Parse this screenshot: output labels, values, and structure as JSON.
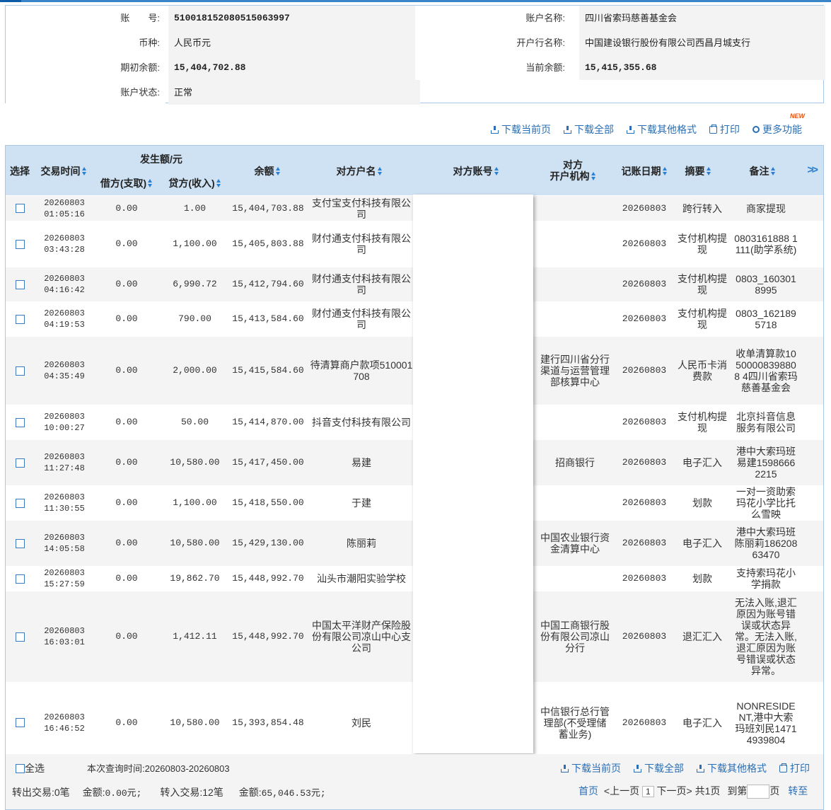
{
  "account": {
    "account_no_label": "账　　号:",
    "account_no": "510018152080515063997",
    "account_name_label": "账户名称:",
    "account_name": "四川省索玛慈善基金会",
    "currency_label": "币种:",
    "currency": "人民币元",
    "bank_label": "开户行名称:",
    "bank": "中国建设银行股份有限公司西昌月城支行",
    "opening_balance_label": "期初余额:",
    "opening_balance": "15,404,702.88",
    "current_balance_label": "当前余额:",
    "current_balance": "15,415,355.68",
    "status_label": "账户状态:",
    "status": "正常"
  },
  "toolbar": {
    "new_badge": "NEW",
    "download_page": "下载当前页",
    "download_all": "下载全部",
    "download_other": "下载其他格式",
    "print": "打印",
    "more": "更多功能"
  },
  "table": {
    "headers": {
      "select": "选择",
      "time": "交易时间",
      "amount_group": "发生额/元",
      "debit": "借方(支取)",
      "credit": "贷方(收入)",
      "balance": "余额",
      "counterparty": "对方户名",
      "counter_account": "对方账号",
      "counter_bank_1": "对方",
      "counter_bank_2": "开户机构",
      "post_date": "记账日期",
      "summary": "摘要",
      "remark": "备注",
      "more": ">>"
    },
    "rows": [
      {
        "date": "20260803",
        "time": "01:05:16",
        "debit": "0.00",
        "credit": "1.00",
        "balance": "15,404,703.88",
        "counterparty": "支付宝支付科技有限公司",
        "bank": "",
        "post": "20260803",
        "summary": "跨行转入",
        "remark": "商家提现"
      },
      {
        "date": "20260803",
        "time": "03:43:28",
        "debit": "0.00",
        "credit": "1,100.00",
        "balance": "15,405,803.88",
        "counterparty": "财付通支付科技有限公司",
        "bank": "",
        "post": "20260803",
        "summary": "支付机构提现",
        "remark": "0803161888 1111(助学系统)"
      },
      {
        "date": "20260803",
        "time": "04:16:42",
        "debit": "0.00",
        "credit": "6,990.72",
        "balance": "15,412,794.60",
        "counterparty": "财付通支付科技有限公司",
        "bank": "",
        "post": "20260803",
        "summary": "支付机构提现",
        "remark": "0803_1603018995"
      },
      {
        "date": "20260803",
        "time": "04:19:53",
        "debit": "0.00",
        "credit": "790.00",
        "balance": "15,413,584.60",
        "counterparty": "财付通支付科技有限公司",
        "bank": "",
        "post": "20260803",
        "summary": "支付机构提现",
        "remark": "0803_1621895718"
      },
      {
        "date": "20260803",
        "time": "04:35:49",
        "debit": "0.00",
        "credit": "2,000.00",
        "balance": "15,415,584.60",
        "counterparty": "待清算商户款项510001708",
        "bank": "建行四川省分行渠道与运营管理部核算中心",
        "post": "20260803",
        "summary": "人民币卡消费款",
        "remark": "收单清算款10500008398808 4四川省索玛慈善基金会"
      },
      {
        "date": "20260803",
        "time": "10:00:27",
        "debit": "0.00",
        "credit": "50.00",
        "balance": "15,414,870.00",
        "counterparty": "抖音支付科技有限公司",
        "bank": "",
        "post": "20260803",
        "summary": "支付机构提现",
        "remark": "北京抖音信息服务有限公司"
      },
      {
        "date": "20260803",
        "time": "11:27:48",
        "debit": "0.00",
        "credit": "10,580.00",
        "balance": "15,417,450.00",
        "counterparty": "易建",
        "bank": "招商银行",
        "post": "20260803",
        "summary": "电子汇入",
        "remark": "港中大索玛班易建15986662215"
      },
      {
        "date": "20260803",
        "time": "11:30:55",
        "debit": "0.00",
        "credit": "1,100.00",
        "balance": "15,418,550.00",
        "counterparty": "于建",
        "bank": "",
        "post": "20260803",
        "summary": "划款",
        "remark": "一对一资助索玛花小学比托么雪映"
      },
      {
        "date": "20260803",
        "time": "14:05:58",
        "debit": "0.00",
        "credit": "10,580.00",
        "balance": "15,429,130.00",
        "counterparty": "陈丽莉",
        "bank": "中国农业银行资金清算中心",
        "post": "20260803",
        "summary": "电子汇入",
        "remark": "港中大索玛班陈丽莉18620863470"
      },
      {
        "date": "20260803",
        "time": "15:27:59",
        "debit": "0.00",
        "credit": "19,862.70",
        "balance": "15,448,992.70",
        "counterparty": "汕头市潮阳实验学校",
        "bank": "",
        "post": "20260803",
        "summary": "划款",
        "remark": "支持索玛花小学捐款"
      },
      {
        "date": "20260803",
        "time": "16:03:01",
        "debit": "0.00",
        "credit": "1,412.11",
        "balance": "15,448,992.70",
        "counterparty": "中国太平洋财产保险股份有限公司凉山中心支公司",
        "bank": "中国工商银行股份有限公司凉山分行",
        "post": "20260803",
        "summary": "退汇汇入",
        "remark": "无法入账,退汇原因为账号错误或状态异常。无法入账,退汇原因为账号错误或状态异常。"
      },
      {
        "date": "20260803",
        "time": "16:46:52",
        "debit": "0.00",
        "credit": "10,580.00",
        "balance": "15,393,854.48",
        "counterparty": "刘民",
        "bank": "中信银行总行管理部(不受理储蓄业务)",
        "post": "20260803",
        "summary": "电子汇入",
        "remark": "NONRESIDENT,港中大索玛班刘民14714939804"
      }
    ]
  },
  "footer": {
    "select_all": "全选",
    "query_time": "本次查询时间:20260803-20260803",
    "download_page": "下载当前页",
    "download_all": "下载全部",
    "download_other": "下载其他格式",
    "print": "打印",
    "out_label": "转出交易:",
    "out_count": "0笔",
    "out_amount_label": "金额:",
    "out_amount": "0.00元;",
    "in_label": "转入交易:",
    "in_count": "12笔",
    "in_amount_label": "金额:",
    "in_amount": "65,046.53元;",
    "first": "首页",
    "prev": "<上一页",
    "page": "1",
    "next": "下一页>",
    "total": "共1页",
    "goto": "到第",
    "page_unit": "页",
    "go": "转至"
  }
}
